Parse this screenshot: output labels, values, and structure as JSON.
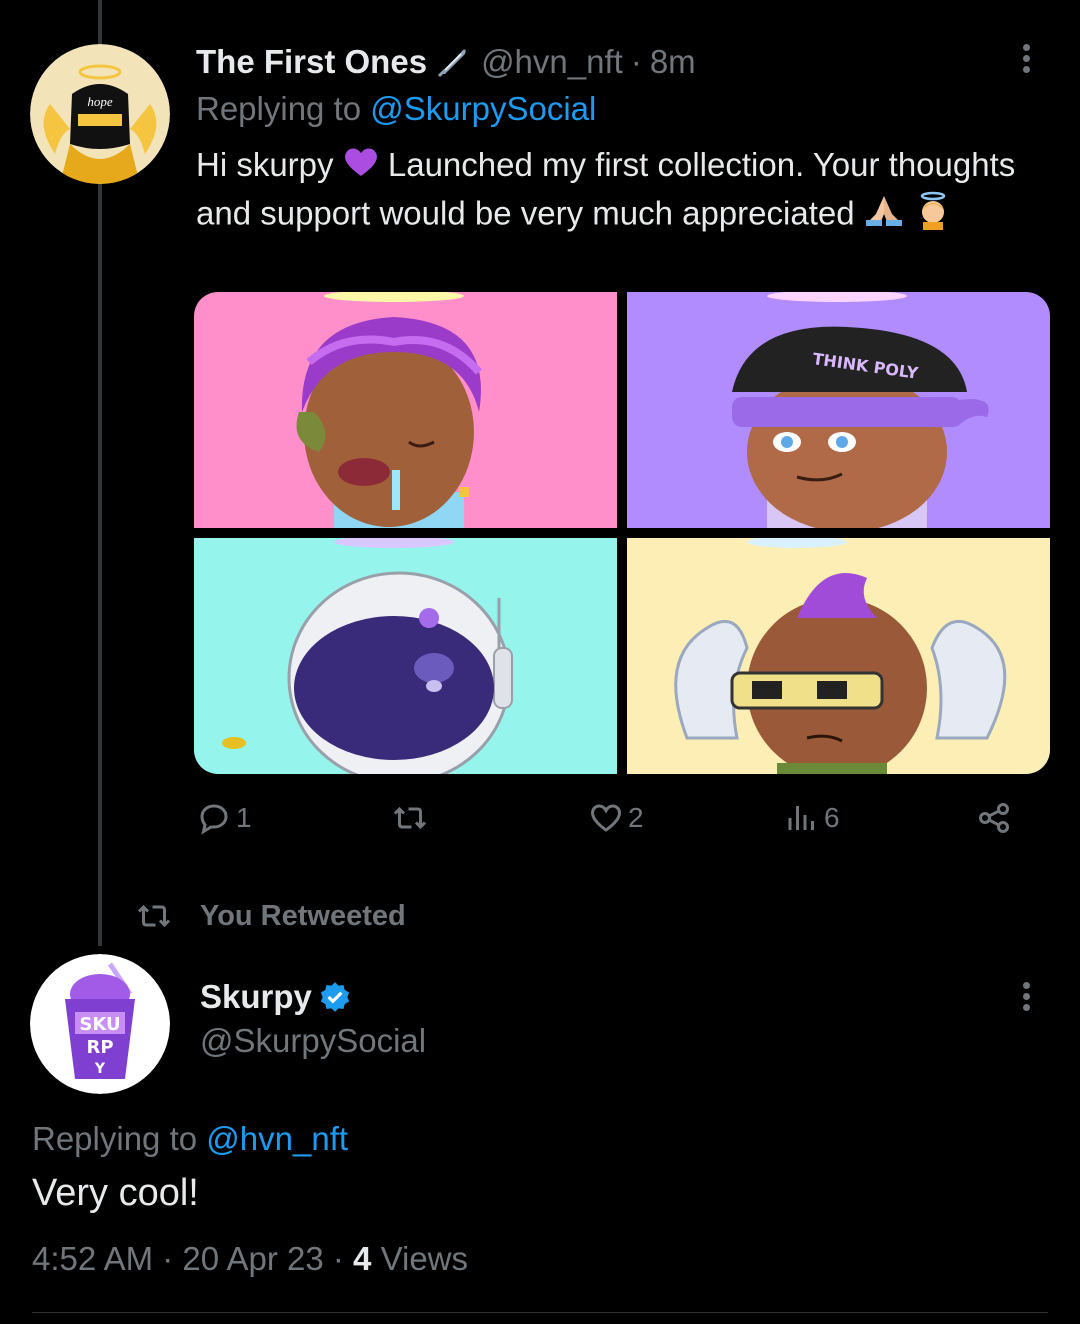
{
  "tweet1": {
    "display_name": "The First Ones",
    "handle": "@hvn_nft",
    "time": "8m",
    "replying_prefix": "Replying to",
    "replying_to": "@SkurpySocial",
    "text_part1": "Hi skurpy",
    "text_part2": "Launched my first collection. Your thoughts and support would be very much appreciated",
    "avatar_text": "hope",
    "media": [
      {
        "bg": "#ff8fcb"
      },
      {
        "bg": "#b18cff",
        "cap_text": "THINK POLY"
      },
      {
        "bg": "#95f5ec"
      },
      {
        "bg": "#fdeeb5"
      }
    ],
    "actions": {
      "replies": "1",
      "retweets": "",
      "likes": "2",
      "views": "6"
    }
  },
  "retweet_banner": "You Retweeted",
  "tweet2": {
    "display_name": "Skurpy",
    "handle": "@SkurpySocial",
    "replying_prefix": "Replying to",
    "replying_to": "@hvn_nft",
    "text": "Very cool!",
    "time": "4:52 AM",
    "date": "20 Apr 23",
    "views_count": "4",
    "views_label": "Views",
    "avatar_text": [
      "SKU",
      "RP",
      "Y"
    ]
  },
  "colors": {
    "accent": "#1d9bf0",
    "muted": "#71767b",
    "text": "#e7e9ea",
    "purple": "#8e3fd6"
  }
}
